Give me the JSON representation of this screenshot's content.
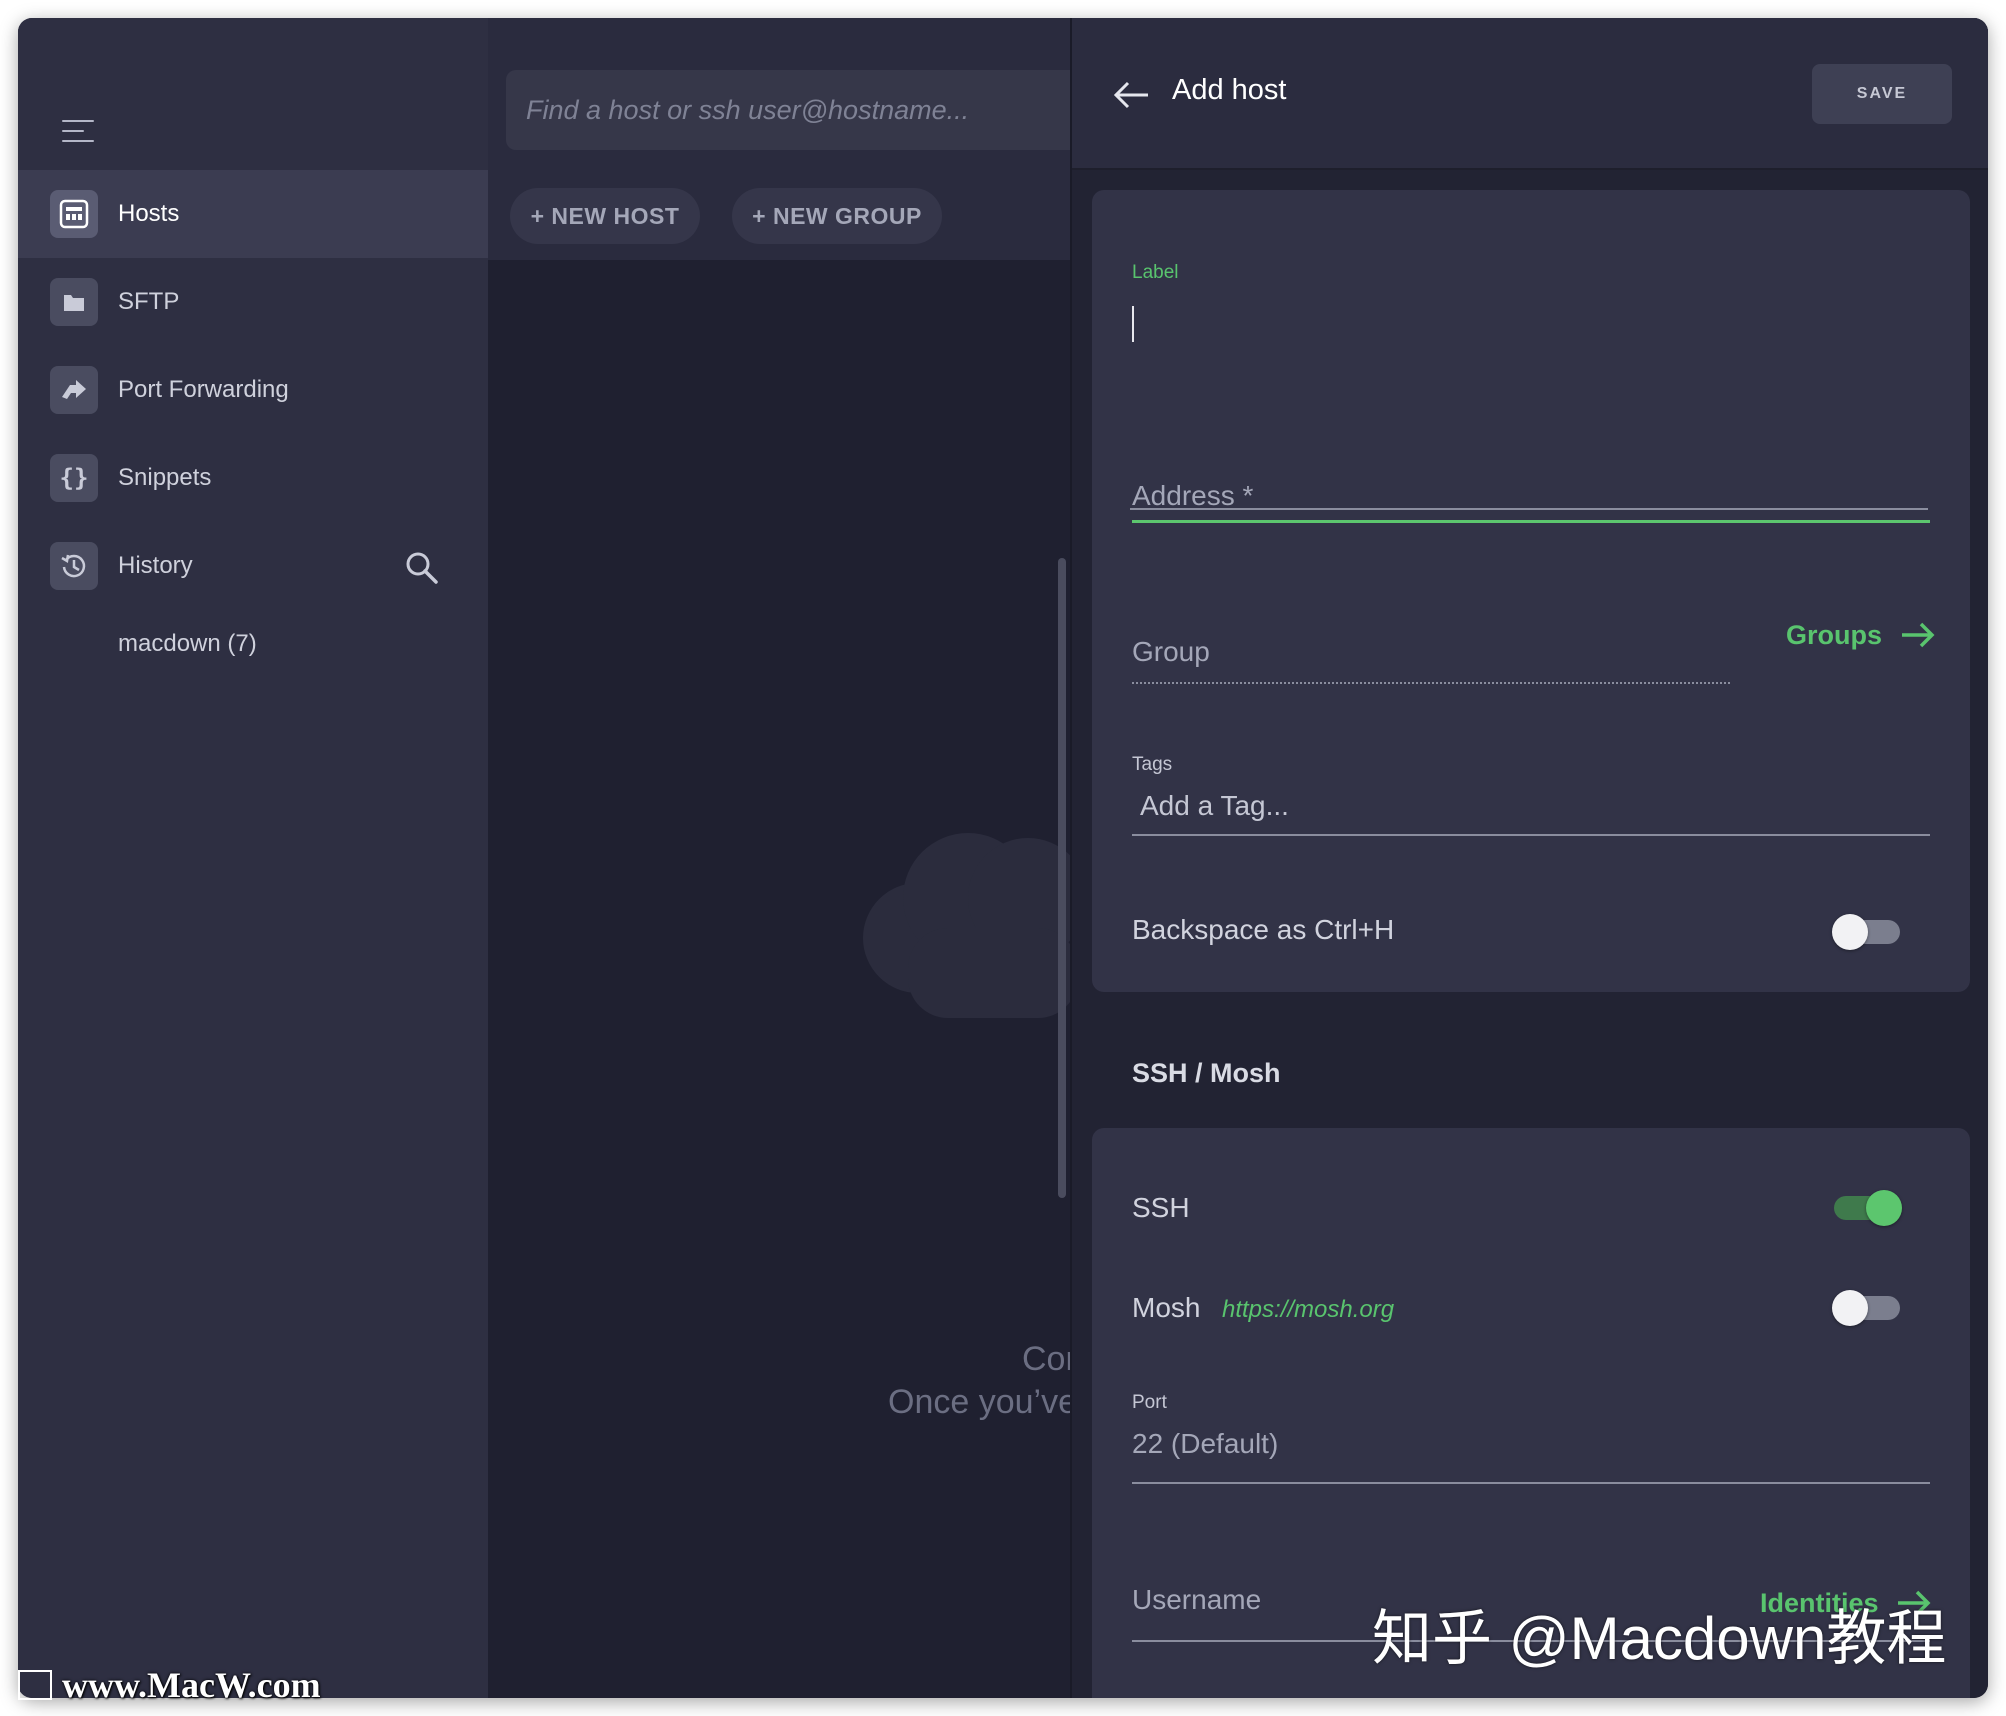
{
  "sidebar": {
    "items": [
      {
        "label": "Hosts",
        "icon": "hosts-icon",
        "active": true
      },
      {
        "label": "SFTP",
        "icon": "folder-icon",
        "active": false
      },
      {
        "label": "Port Forwarding",
        "icon": "port-forwarding-icon",
        "active": false
      },
      {
        "label": "Snippets",
        "icon": "snippets-icon",
        "active": false
      },
      {
        "label": "History",
        "icon": "history-icon",
        "active": false
      }
    ],
    "group_entry": "macdown (7)"
  },
  "search": {
    "placeholder": "Find a host or ssh user@hostname..."
  },
  "toolbar": {
    "new_host": "+ NEW HOST",
    "new_group": "+ NEW GROUP"
  },
  "empty_state": {
    "title": "Con",
    "subtitle": "Once you’ve"
  },
  "panel": {
    "title": "Add host",
    "save_label": "SAVE",
    "label_field": {
      "label": "Label",
      "value": ""
    },
    "address_field": {
      "placeholder": "Address *"
    },
    "group_field": {
      "placeholder": "Group",
      "link": "Groups"
    },
    "tags_field": {
      "label": "Tags",
      "placeholder": "Add a Tag..."
    },
    "backspace": {
      "label": "Backspace as Ctrl+H",
      "enabled": false
    },
    "section_title": "SSH / Mosh",
    "ssh": {
      "label": "SSH",
      "enabled": true
    },
    "mosh": {
      "label": "Mosh",
      "link": "https://mosh.org",
      "enabled": false
    },
    "port_field": {
      "label": "Port",
      "placeholder": "22 (Default)"
    },
    "username_field": {
      "placeholder": "Username",
      "link": "Identities"
    }
  },
  "colors": {
    "accent_green": "#59c46e",
    "sidebar_bg": "#2e2f42",
    "panel_bg": "#222333",
    "card_bg": "#323347"
  },
  "watermarks": {
    "zh": "知乎 @Macdown教程",
    "url": "www.MacW.com"
  }
}
